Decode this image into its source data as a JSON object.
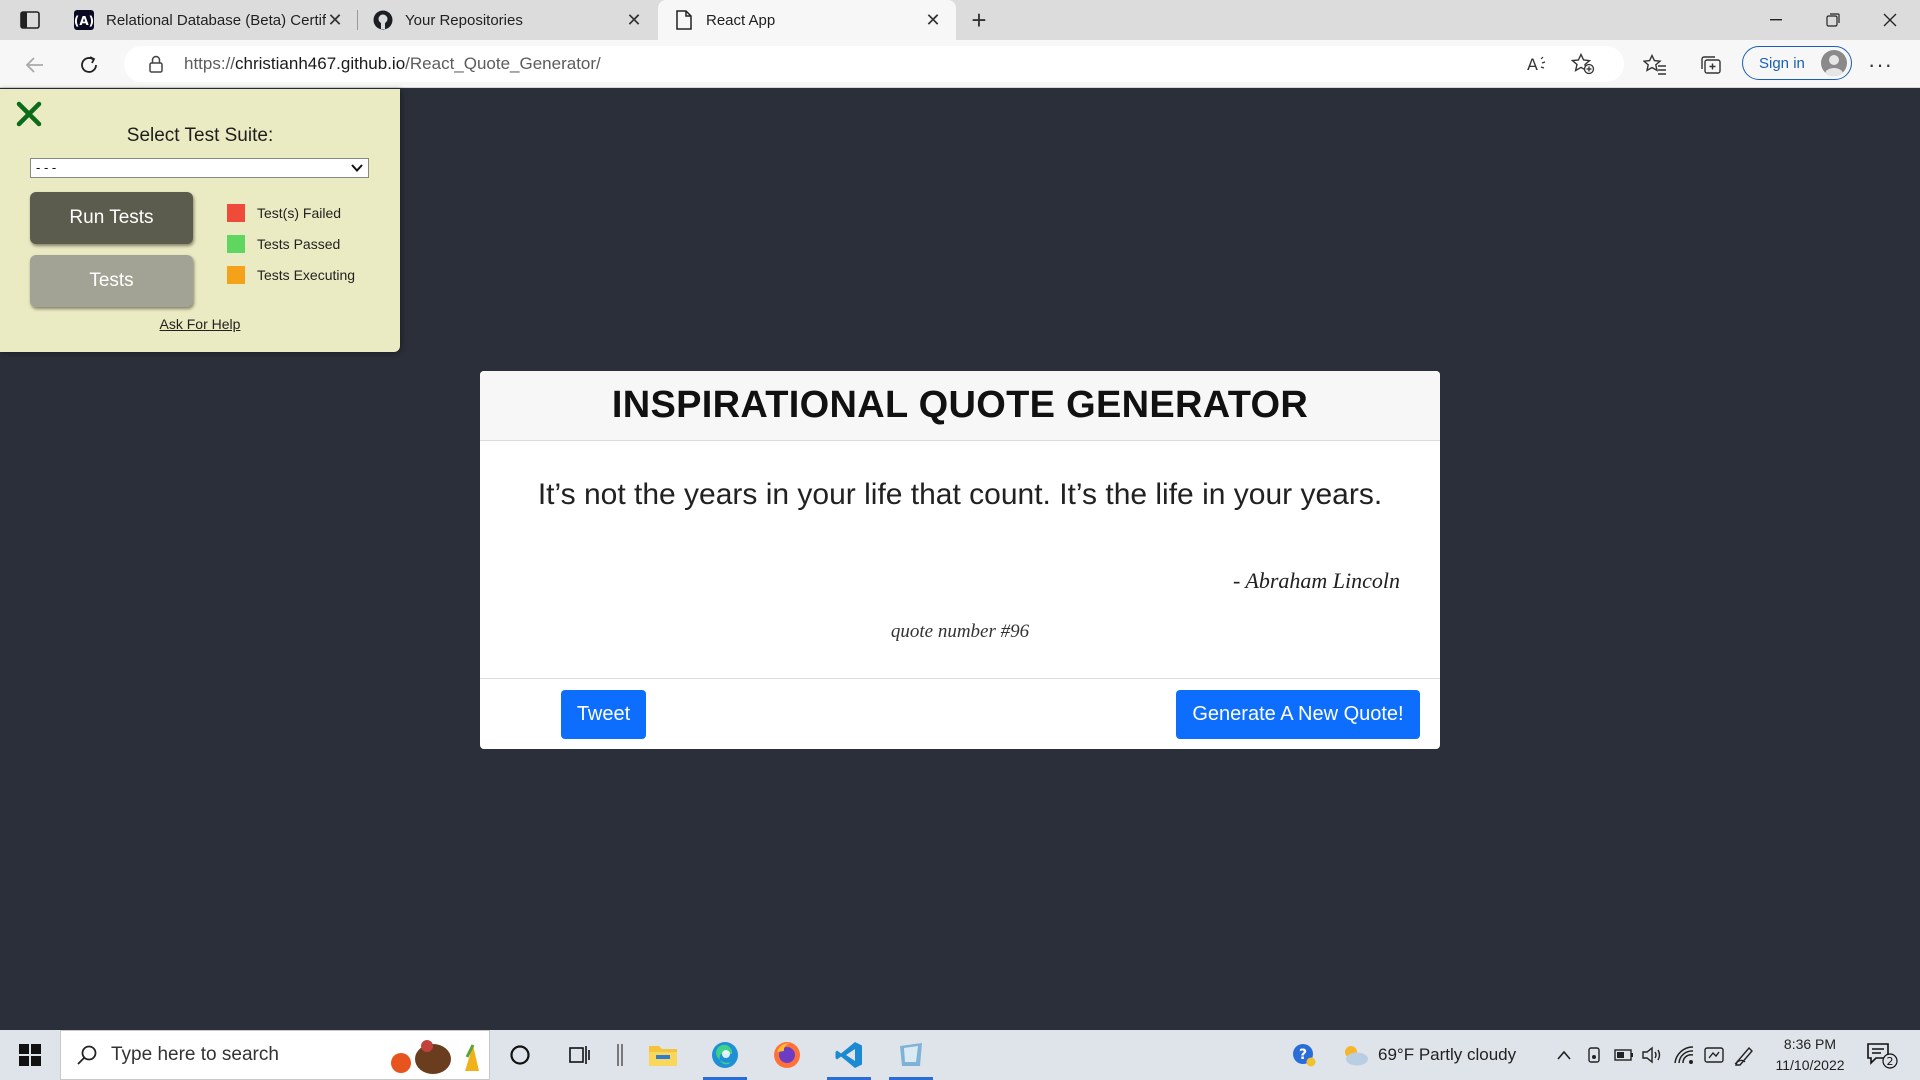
{
  "browser": {
    "tabs": [
      {
        "title": "Relational Database (Beta) Certifi",
        "active": false
      },
      {
        "title": "Your Repositories",
        "active": false
      },
      {
        "title": "React App",
        "active": true
      }
    ],
    "url_scheme": "https://",
    "url_host": "christianh467.github.io",
    "url_path": "/React_Quote_Generator/",
    "signin_label": "Sign in",
    "menu_label": "···"
  },
  "fcc_panel": {
    "select_label": "Select Test Suite:",
    "select_value": "- - -",
    "run_button": "Run Tests",
    "tests_button": "Tests",
    "legend": [
      {
        "label": "Test(s) Failed",
        "color": "#ef4b3b"
      },
      {
        "label": "Tests Passed",
        "color": "#5fd65f"
      },
      {
        "label": "Tests Executing",
        "color": "#f5a21b"
      }
    ],
    "help_link": "Ask For Help"
  },
  "quote_card": {
    "title": "INSPIRATIONAL QUOTE GENERATOR",
    "quote": "It’s not the years in your life that count. It’s the life in your years.",
    "author": "- Abraham Lincoln",
    "quote_number": "quote number #96",
    "tweet_button": "Tweet",
    "new_quote_button": "Generate A New Quote!"
  },
  "taskbar": {
    "search_placeholder": "Type here to search",
    "weather": "69°F  Partly cloudy",
    "time": "8:36 PM",
    "date": "11/10/2022",
    "notification_count": "2"
  },
  "colors": {
    "page_bg": "#2a2f3a",
    "panel_bg": "#ebebc3",
    "primary": "#0d6efd",
    "close_x": "#0b6b1a"
  }
}
